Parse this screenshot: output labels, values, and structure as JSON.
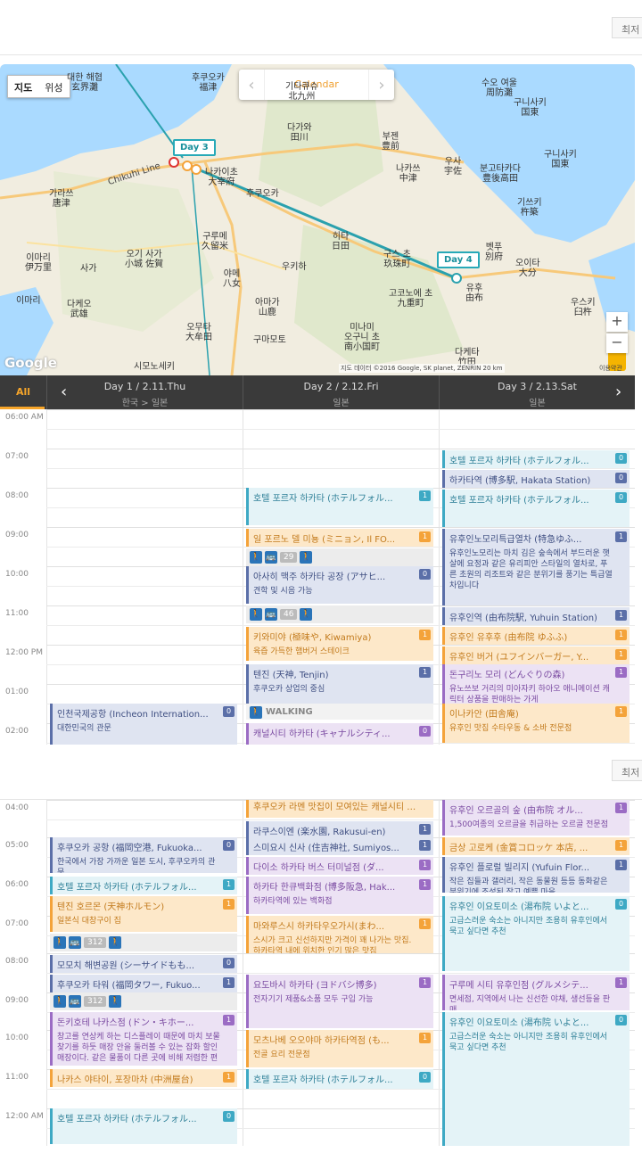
{
  "topbar": {
    "latest_label": "최저"
  },
  "map": {
    "toggle": [
      "지도",
      "위성"
    ],
    "calendar_label": "Calendar",
    "labels": [
      {
        "text": "대한 해협\n玄界灘"
      },
      {
        "text": "후쿠오카\n福津"
      },
      {
        "text": "다가와\n田川"
      },
      {
        "text": "부젠\n豊前"
      },
      {
        "text": "우사\n宇佐"
      },
      {
        "text": "나카쓰\n中津"
      },
      {
        "text": "분고타카다\n豊後高田"
      },
      {
        "text": "기쓰키\n杵築"
      },
      {
        "text": "구니사키\n国東"
      },
      {
        "text": "오이타\n大分"
      },
      {
        "text": "벳푸\n別府"
      },
      {
        "text": "유후\n由布"
      },
      {
        "text": "고코노에 초\n九重町"
      },
      {
        "text": "히타\n日田"
      },
      {
        "text": "후쿠오카"
      },
      {
        "text": "구루메\n久留米"
      },
      {
        "text": "오기 사가\n小城 佐賀"
      },
      {
        "text": "이마리\n伊万里"
      },
      {
        "text": "가라쓰\n唐津"
      },
      {
        "text": "야메\n八女"
      },
      {
        "text": "오무타\n大牟田"
      },
      {
        "text": "다케오\n武雄"
      },
      {
        "text": "구마모토"
      },
      {
        "text": "다케타\n竹田"
      },
      {
        "text": "우스키\n臼杵"
      },
      {
        "text": "사가"
      },
      {
        "text": "나카이초\n大宰府"
      },
      {
        "text": "구스 초\n玖珠町"
      },
      {
        "text": "수오 여울\n周防灘"
      },
      {
        "text": "기타큐슈\n北九州"
      },
      {
        "text": "이마리"
      },
      {
        "text": "우키하"
      },
      {
        "text": "아마가\n山鹿"
      },
      {
        "text": "미나미\n오구니 초\n南小国町"
      },
      {
        "text": "구니사키\n国東"
      },
      {
        "text": "시모노세키"
      }
    ],
    "day_pins": [
      "Day 3",
      "Day 4"
    ],
    "road_label": "Chikuhi Line",
    "google_logo": "Google",
    "attribution": "지도 데이터 ©2016 Google, SK planet, ZENRIN   20 km",
    "rights_label": "이용약관"
  },
  "day_header": {
    "all_label": "All",
    "days": [
      {
        "title": "Day 1  /  2.11.Thu",
        "sub": "한국 > 일본"
      },
      {
        "title": "Day 2  /  2.12.Fri",
        "sub": "일본"
      },
      {
        "title": "Day 3  /  2.13.Sat",
        "sub": "일본"
      }
    ]
  },
  "grid1": {
    "times": [
      "06:00 AM",
      "07:00",
      "08:00",
      "09:00",
      "10:00",
      "11:00",
      "12:00 PM",
      "01:00",
      "02:00"
    ]
  },
  "grid2": {
    "times": [
      "04:00",
      "05:00",
      "06:00",
      "07:00",
      "08:00",
      "09:00",
      "10:00",
      "11:00",
      "12:00 AM"
    ]
  },
  "events1": [
    {
      "col": 2,
      "cat": "hotel",
      "title": "호텔 포르자 하카타 (ホテルフォル...",
      "badge": "0"
    },
    {
      "col": 2,
      "cat": "sight",
      "title": "하카타역 (博多駅, Hakata Station)",
      "badge": "0"
    },
    {
      "col": 1,
      "cat": "hotel",
      "title": "호텔 포르자 하카타 (ホテルフォル...",
      "badge": "1"
    },
    {
      "col": 2,
      "cat": "hotel",
      "title": "호텔 포르자 하카타 (ホテルフォル...",
      "badge": "0"
    },
    {
      "col": 1,
      "cat": "food",
      "title": "일 포르노 델 미뇽 (ミニョン, Il FO...",
      "badge": "1"
    },
    {
      "col": 2,
      "cat": "sight",
      "title": "유후인노모리특급열차 (特急ゆふ...",
      "badge": "1",
      "sub": "유후인노모리는 마치 김은 숲속에서 부드러운 햇살에 요정과 같은 유리피안 스타일의 열차로, 푸른 초원의 리조트와 같은 분위기를 풍기는 특급열차입니다"
    },
    {
      "col": 1,
      "cat": "sight",
      "title": "아사히 맥주 하카타 공장 (アサヒ...",
      "badge": "0",
      "sub": "견학 및 시음 가능"
    },
    {
      "col": 2,
      "cat": "sight",
      "title": "유후인역 (由布院駅, Yuhuin Station)",
      "badge": "1"
    },
    {
      "col": 1,
      "cat": "food",
      "title": "키와미야 (極味や, Kiwamiya)",
      "badge": "1",
      "sub": "육즙 가득한 햄버거 스테이크"
    },
    {
      "col": 2,
      "cat": "food",
      "title": "유후인 유후후 (由布院 ゆふふ)",
      "badge": "1"
    },
    {
      "col": 2,
      "cat": "food",
      "title": "유후인 버거 (ユフインバーガー, Y...",
      "badge": "1"
    },
    {
      "col": 1,
      "cat": "sight",
      "title": "텐진 (天神, Tenjin)",
      "badge": "1",
      "sub": "후쿠오카 상업의 중심"
    },
    {
      "col": 2,
      "cat": "shop",
      "title": "돈구리노 모리 (どんぐりの森)",
      "badge": "1",
      "sub": "유노쓰보 거리의 미아자키 하아오 애니메이션 캐릭터 상품을 판매하는 가게"
    },
    {
      "col": 0,
      "cat": "sight",
      "title": "인천국제공항 (Incheon Internation...",
      "badge": "0",
      "sub": "대한민국의 관문"
    },
    {
      "col": 2,
      "cat": "food",
      "title": "이나카안 (田舎庵)",
      "badge": "1",
      "sub": "유후인 맛집 수타우동 & 소바 전문점"
    },
    {
      "col": 1,
      "cat": "shop",
      "title": "캐널시티 하카타 (キャナルシティ...",
      "badge": "0"
    }
  ],
  "transport1": [
    {
      "num": "29"
    },
    {
      "num": "46"
    }
  ],
  "walking_label": "WALKING",
  "events2": [
    {
      "col": 1,
      "cat": "food",
      "title": "후쿠오카 라멘 맛집이 모여있는 캐널시티 라멘스타디움",
      "badge": ""
    },
    {
      "col": 2,
      "cat": "shop",
      "title": "유후인 오르골의 숲 (由布院 オル...",
      "badge": "1",
      "sub": "1,500여종의 오르골을 취급하는 오르골 전문점"
    },
    {
      "col": 1,
      "cat": "sight",
      "title": "라쿠스이엔 (楽水園, Rakusui-en)",
      "badge": "1"
    },
    {
      "col": 0,
      "cat": "sight",
      "title": "후쿠오카 공항 (福岡空港, Fukuoka...",
      "badge": "0",
      "sub": "한국에서 가장 가까운 일본 도시, 후쿠오카의 관문"
    },
    {
      "col": 1,
      "cat": "sight",
      "title": "스미요시 신사 (住吉神社, Sumiyos...",
      "badge": "1"
    },
    {
      "col": 2,
      "cat": "food",
      "title": "금상 고로케 (金賞コロッケ 本店, ...",
      "badge": "1"
    },
    {
      "col": 1,
      "cat": "shop",
      "title": "다이소 하카타 버스 터미널점 (ダ...",
      "badge": "1"
    },
    {
      "col": 2,
      "cat": "sight",
      "title": "유후인 플로럴 빌리지 (Yufuin Flor...",
      "badge": "1",
      "sub": "작은 집들과 갤러리, 작은 동물원 등등 동화같은 분위기에 조성된 작고 예쁜 마을"
    },
    {
      "col": 0,
      "cat": "hotel",
      "title": "호텔 포르자 하카타 (ホテルフォル...",
      "badge": "1"
    },
    {
      "col": 1,
      "cat": "shop",
      "title": "하카타 한큐백화점 (博多阪急, Hak...",
      "badge": "1",
      "sub": "하카타역에 있는 백화점"
    },
    {
      "col": 2,
      "cat": "hotel",
      "title": "유후인 이요토미소 (湯布院 いよと...",
      "badge": "0",
      "sub": "고급스러운 숙소는 아니지만 조용히 유후인에서 묵고 싶다면 추천"
    },
    {
      "col": 0,
      "cat": "food",
      "title": "텐진 호르몬 (天神ホルモン)",
      "badge": "1",
      "sub": "일본식 대창구이 집"
    },
    {
      "col": 1,
      "cat": "food",
      "title": "마와루스시 하카타우오가시(まわ...",
      "badge": "1",
      "sub": "스시가 크고 신선하지만 가격이 꽤 나가는 맛집. 하카타역 내에 위치한 인기 많은 맛집"
    },
    {
      "col": 0,
      "cat": "sight",
      "title": "모모치 해변공원 (シーサイドもも...",
      "badge": "0"
    },
    {
      "col": 0,
      "cat": "sight",
      "title": "후쿠오카 타워 (福岡タワー, Fukuo...",
      "badge": "1"
    },
    {
      "col": 1,
      "cat": "shop",
      "title": "요도바시 하카타 (ヨドバシ博多)",
      "badge": "1",
      "sub": "전자기기 제품&소품 모두 구입 가능"
    },
    {
      "col": 2,
      "cat": "shop",
      "title": "구루메 시티 유후인점 (グルメシテ...",
      "badge": "1",
      "sub": "면세점, 지역에서 나는 신선한 야채, 생선등을 판매"
    },
    {
      "col": 2,
      "cat": "hotel",
      "title": "유후인 이요토미소 (湯布院 いよと...",
      "badge": "0",
      "sub": "고급스러운 숙소는 아니지만 조용히 유후인에서 묵고 싶다면 추천"
    },
    {
      "col": 0,
      "cat": "shop",
      "title": "돈키호테 나카스점 (ドン・キホー...",
      "badge": "1",
      "sub": "창고를 연상케 하는 디스플레이 때문에 마치 보물찾기를 하듯 매장 안을 둘러볼 수 있는 잡화 할인매장이다. 같은 물품이 다른 곳에 비해 저렴한 편"
    },
    {
      "col": 1,
      "cat": "food",
      "title": "모츠나베 오오야마 하카타역점 (も...",
      "badge": "1",
      "sub": "전골 요리 전문점"
    },
    {
      "col": 0,
      "cat": "food",
      "title": "나카스 야타이, 포장마차 (中洲屋台)",
      "badge": "1"
    },
    {
      "col": 1,
      "cat": "hotel",
      "title": "호텔 포르자 하카타 (ホテルフォル...",
      "badge": "0"
    },
    {
      "col": 0,
      "cat": "hotel",
      "title": "호텔 포르자 하카타 (ホテルフォル...",
      "badge": "0"
    }
  ],
  "transport2": [
    {
      "num": "312"
    },
    {
      "num": "312"
    }
  ],
  "colors": {
    "accent": "#f6a52a",
    "header_bg": "#3a3a3a",
    "route": "#27a9b8"
  }
}
